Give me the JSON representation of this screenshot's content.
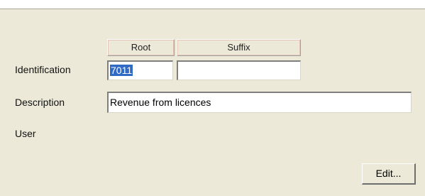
{
  "columns": {
    "root_label": "Root",
    "suffix_label": "Suffix"
  },
  "identification": {
    "label": "Identification",
    "root_value": "7011",
    "suffix_value": ""
  },
  "description": {
    "label": "Description",
    "value": "Revenue from licences"
  },
  "user": {
    "label": "User"
  },
  "actions": {
    "edit_label": "Edit..."
  },
  "colors": {
    "background": "#ece9d8",
    "selection": "#316ac5"
  }
}
